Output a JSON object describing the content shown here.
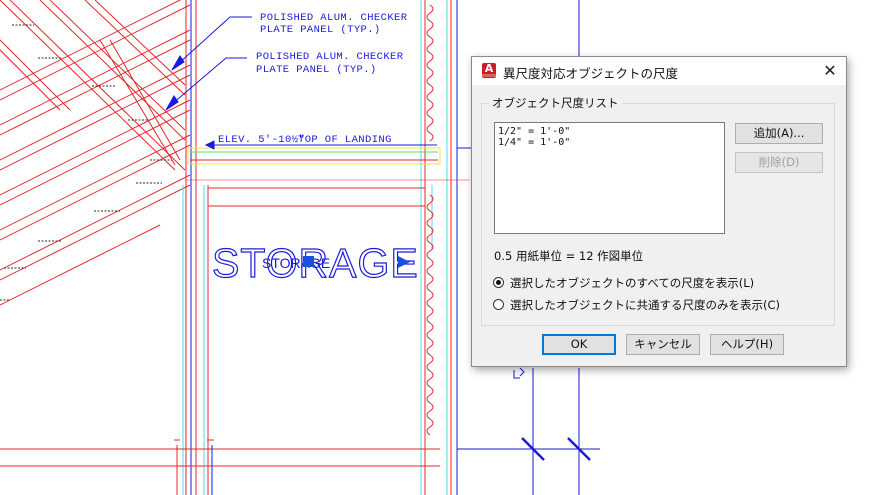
{
  "drawing": {
    "callout_1_line1": "POLISHED ALUM. CHECKER",
    "callout_1_line2": "PLATE PANEL (TYP.)",
    "callout_2_line1": "POLISHED ALUM. CHECKER",
    "callout_2_line2": "PLATE PANEL (TYP.)",
    "elevation_label": "ELEV. 5'-10½\"",
    "elevation_suffix": "TOP OF LANDING",
    "room_label_large": "STORAGE",
    "room_label_small": "STORAGE",
    "colors": {
      "red": "#e8252b",
      "blue": "#1a1adc",
      "cyan": "#56d8e8",
      "yellow": "#e5e550",
      "green": "#6ad86a"
    }
  },
  "dialog": {
    "icon_letter": "A",
    "title": "異尺度対応オブジェクトの尺度",
    "close_glyph": "✕",
    "group_label": "オブジェクト尺度リスト",
    "scale_list": [
      "1/2\" = 1'-0\"",
      "1/4\" = 1'-0\""
    ],
    "add_button": "追加(A)...",
    "delete_button": "削除(D)",
    "ratio_text": "0.5 用紙単位 = 12 作図単位",
    "radio_options": [
      {
        "label": "選択したオブジェクトのすべての尺度を表示(L)",
        "checked": true
      },
      {
        "label": "選択したオブジェクトに共通する尺度のみを表示(C)",
        "checked": false
      }
    ],
    "ok_button": "OK",
    "cancel_button": "キャンセル",
    "help_button": "ヘルプ(H)"
  }
}
